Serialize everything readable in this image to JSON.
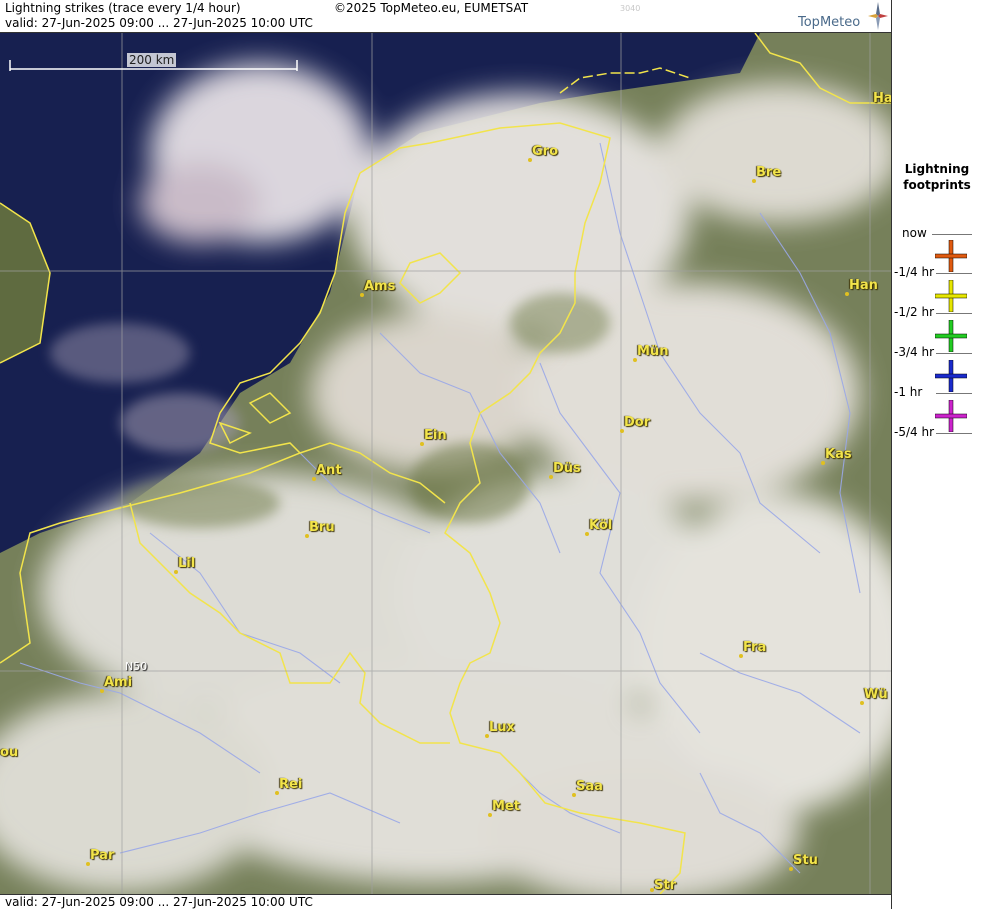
{
  "header": {
    "title": "Lightning strikes (trace every 1/4 hour)",
    "valid": "valid:  27-Jun-2025 09:00 ... 27-Jun-2025 10:00 UTC",
    "copyright": "©2025 TopMeteo.eu, EUMETSAT",
    "code": "3040",
    "logo": "TopMeteo"
  },
  "footer": {
    "valid": "valid:  27-Jun-2025 09:00 ... 27-Jun-2025 10:00 UTC"
  },
  "map": {
    "scale_label": "200 km",
    "grid_label": "N50",
    "cities": [
      {
        "name": "Gro"
      },
      {
        "name": "Bre"
      },
      {
        "name": "Ha"
      },
      {
        "name": "Ams"
      },
      {
        "name": "Han"
      },
      {
        "name": "Mün"
      },
      {
        "name": "Dor"
      },
      {
        "name": "Ein"
      },
      {
        "name": "Ant"
      },
      {
        "name": "Düs"
      },
      {
        "name": "Kas"
      },
      {
        "name": "Bru"
      },
      {
        "name": "Köl"
      },
      {
        "name": "Lil"
      },
      {
        "name": "Fra"
      },
      {
        "name": "Ami"
      },
      {
        "name": "Wü"
      },
      {
        "name": "Lux"
      },
      {
        "name": "ou"
      },
      {
        "name": "Rei"
      },
      {
        "name": "Saa"
      },
      {
        "name": "Met"
      },
      {
        "name": "Par"
      },
      {
        "name": "Stu"
      },
      {
        "name": "Str"
      }
    ]
  },
  "legend": {
    "title_line1": "Lightning",
    "title_line2": "footprints",
    "items": [
      {
        "label": "now",
        "color": "#e05a10"
      },
      {
        "label": "-1/4 hr",
        "color": "#e6e600"
      },
      {
        "label": "-1/2 hr",
        "color": "#22cc22"
      },
      {
        "label": "-3/4 hr",
        "color": "#1a2acc"
      },
      {
        "label": "-1 hr",
        "color": "#cc22cc"
      },
      {
        "label": "-5/4 hr"
      }
    ]
  },
  "colors": {
    "border": "#f2e44b",
    "rivers": "#9aa8e8",
    "sea": "#141c45",
    "land": "#6f7a4a",
    "cloud": "#e8e2e2"
  }
}
